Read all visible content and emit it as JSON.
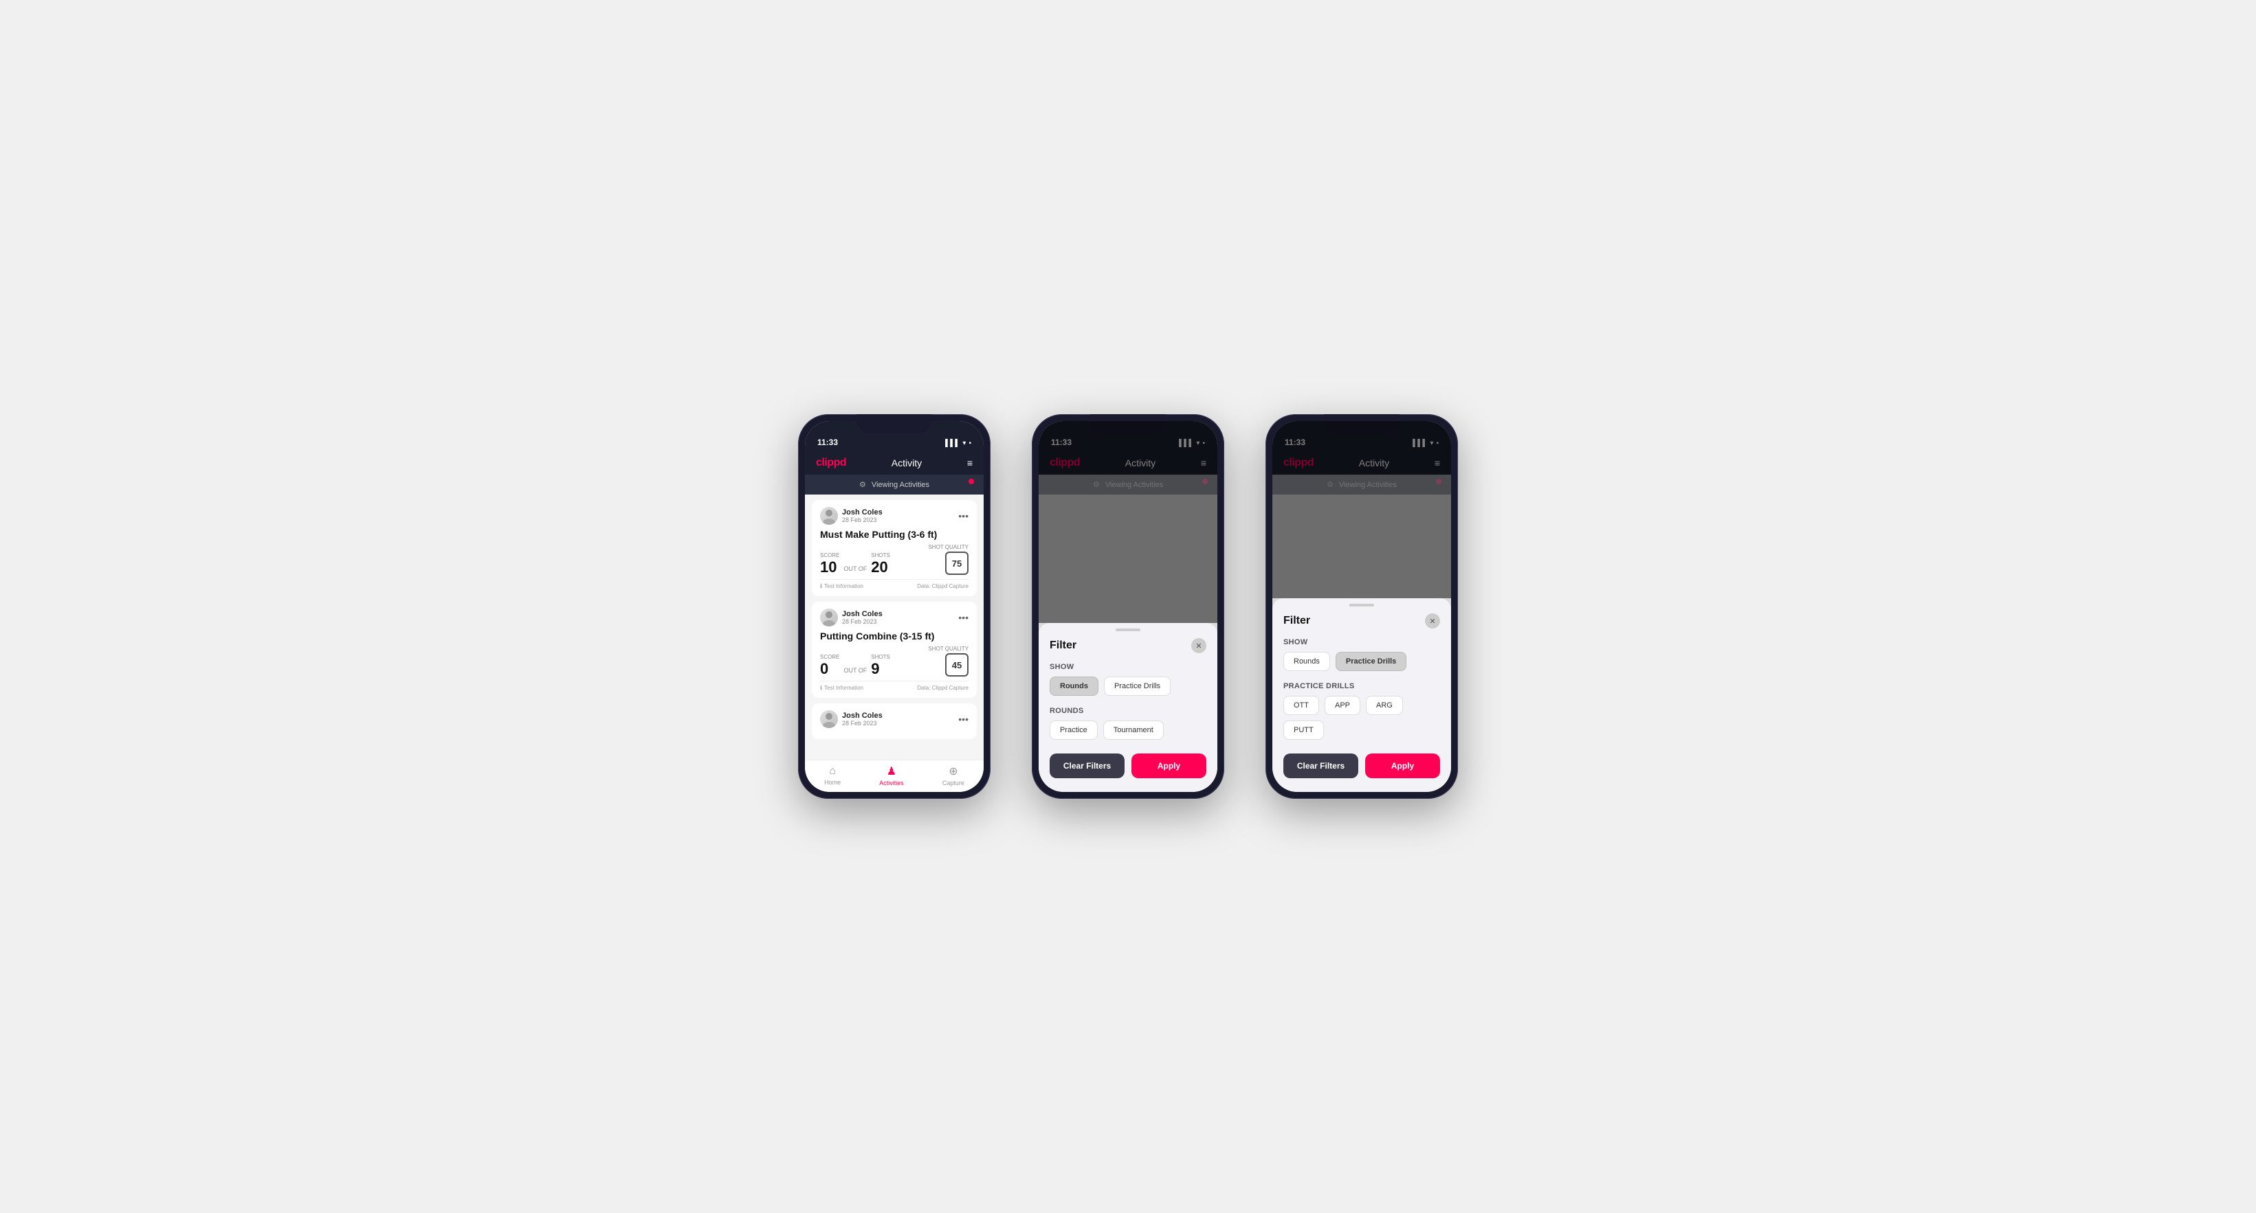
{
  "phones": [
    {
      "id": "phone1",
      "type": "activity-list",
      "status_time": "11:33",
      "header": {
        "logo": "clippd",
        "title": "Activity",
        "menu_icon": "≡"
      },
      "viewing_bar": "Viewing Activities",
      "activities": [
        {
          "user_name": "Josh Coles",
          "user_date": "28 Feb 2023",
          "title": "Must Make Putting (3-6 ft)",
          "score_label": "Score",
          "score_value": "10",
          "shots_label": "Shots",
          "shots_value": "20",
          "shot_quality_label": "Shot Quality",
          "shot_quality_value": "75",
          "footer_info": "Test Information",
          "footer_data": "Data: Clippd Capture"
        },
        {
          "user_name": "Josh Coles",
          "user_date": "28 Feb 2023",
          "title": "Putting Combine (3-15 ft)",
          "score_label": "Score",
          "score_value": "0",
          "shots_label": "Shots",
          "shots_value": "9",
          "shot_quality_label": "Shot Quality",
          "shot_quality_value": "45",
          "footer_info": "Test Information",
          "footer_data": "Data: Clippd Capture"
        },
        {
          "user_name": "Josh Coles",
          "user_date": "28 Feb 2023",
          "title": "",
          "score_label": "",
          "score_value": "",
          "shots_label": "",
          "shots_value": "",
          "shot_quality_label": "",
          "shot_quality_value": "",
          "footer_info": "",
          "footer_data": ""
        }
      ],
      "nav": [
        {
          "icon": "🏠",
          "label": "Home",
          "active": false
        },
        {
          "icon": "♟",
          "label": "Activities",
          "active": true
        },
        {
          "icon": "⊕",
          "label": "Capture",
          "active": false
        }
      ]
    },
    {
      "id": "phone2",
      "type": "filter-modal-rounds",
      "status_time": "11:33",
      "header": {
        "logo": "clippd",
        "title": "Activity",
        "menu_icon": "≡"
      },
      "viewing_bar": "Viewing Activities",
      "filter": {
        "title": "Filter",
        "show_label": "Show",
        "show_buttons": [
          {
            "label": "Rounds",
            "active": true
          },
          {
            "label": "Practice Drills",
            "active": false
          }
        ],
        "rounds_label": "Rounds",
        "rounds_buttons": [
          {
            "label": "Practice",
            "active": false
          },
          {
            "label": "Tournament",
            "active": false
          }
        ],
        "clear_label": "Clear Filters",
        "apply_label": "Apply"
      }
    },
    {
      "id": "phone3",
      "type": "filter-modal-drills",
      "status_time": "11:33",
      "header": {
        "logo": "clippd",
        "title": "Activity",
        "menu_icon": "≡"
      },
      "viewing_bar": "Viewing Activities",
      "filter": {
        "title": "Filter",
        "show_label": "Show",
        "show_buttons": [
          {
            "label": "Rounds",
            "active": false
          },
          {
            "label": "Practice Drills",
            "active": true
          }
        ],
        "drills_label": "Practice Drills",
        "drills_buttons": [
          {
            "label": "OTT",
            "active": false
          },
          {
            "label": "APP",
            "active": false
          },
          {
            "label": "ARG",
            "active": false
          },
          {
            "label": "PUTT",
            "active": false
          }
        ],
        "clear_label": "Clear Filters",
        "apply_label": "Apply"
      }
    }
  ]
}
